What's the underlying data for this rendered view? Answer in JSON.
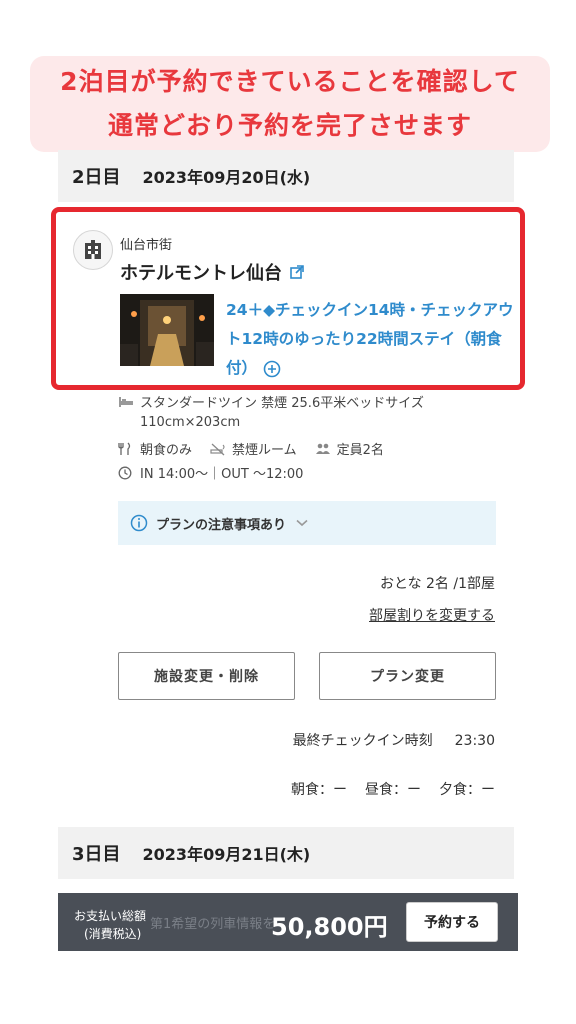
{
  "banner": {
    "line1": "2泊目が予約できていることを確認して",
    "line2": "通常どおり予約を完了させます"
  },
  "day2": {
    "label": "2日目",
    "date": "2023年09月20日(水)"
  },
  "hotel": {
    "area": "仙台市街",
    "name": "ホテルモントレ仙台",
    "plan": "24＋◆チェックイン14時・チェックアウト12時のゆったり22時間ステイ（朝食付）"
  },
  "details": {
    "room": "スタンダードツイン 禁煙 25.6平米ベッドサイズ",
    "bed_size": "110cm×203cm",
    "meal": "朝食のみ",
    "smoking": "禁煙ルーム",
    "capacity": "定員2名",
    "in_out": "IN 14:00〜｜OUT 〜12:00"
  },
  "notice": {
    "label": "プランの注意事項あり"
  },
  "guests": {
    "text": "おとな 2名 /1部屋",
    "link": "部屋割りを変更する"
  },
  "buttons": {
    "change_delete": "施設変更・削除",
    "change_plan": "プラン変更"
  },
  "checkin": {
    "label": "最終チェックイン時刻",
    "time": "23:30"
  },
  "meals": {
    "breakfast": "朝食：ー",
    "lunch": "昼食：ー",
    "dinner": "夕食：ー"
  },
  "day3": {
    "label": "3日目",
    "date": "2023年09月21日(木)"
  },
  "footer": {
    "behind_text": "第1希望の列車情報を",
    "label_line1": "お支払い総額",
    "label_line2": "(消費税込)",
    "total": "50,800円",
    "reserve": "予約する"
  },
  "colors": {
    "accent_red": "#e6282f",
    "link_blue": "#2f8bcc",
    "footer_bg": "#4a4f57"
  },
  "icons": [
    "building-icon",
    "external-link-icon",
    "plus-circle-icon",
    "bed-icon",
    "utensils-icon",
    "no-smoking-icon",
    "people-icon",
    "clock-icon",
    "info-icon",
    "chevron-down-icon"
  ]
}
